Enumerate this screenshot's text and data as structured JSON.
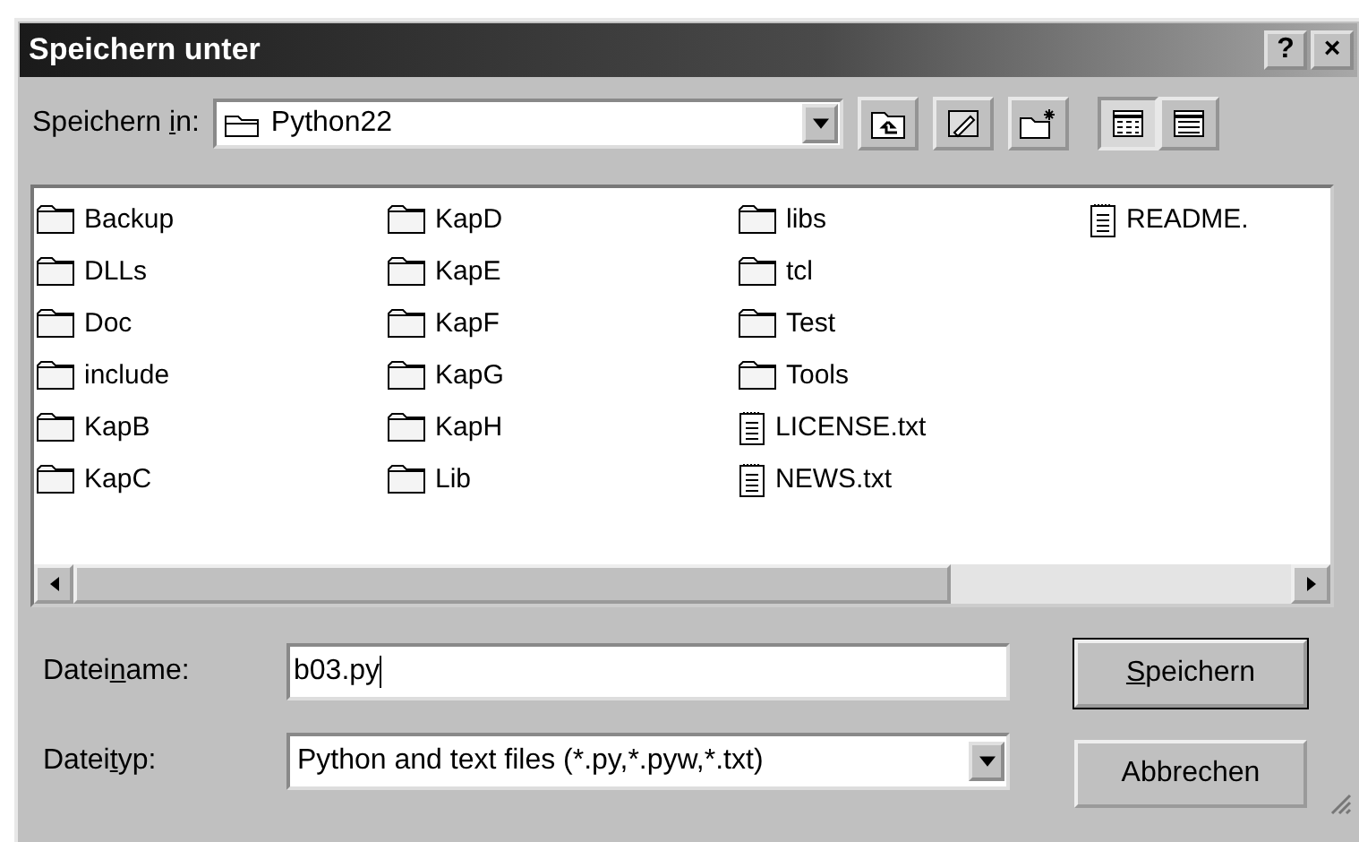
{
  "window": {
    "title": "Speichern unter",
    "help_button": "?",
    "close_button": "×"
  },
  "location": {
    "label": {
      "before": "Speichern ",
      "accel": "i",
      "after": "n:"
    },
    "value": "Python22"
  },
  "view_buttons": [
    {
      "kind": "list",
      "selected": true
    },
    {
      "kind": "details",
      "selected": false
    }
  ],
  "files": [
    {
      "name": "Backup",
      "kind": "folder"
    },
    {
      "name": "DLLs",
      "kind": "folder"
    },
    {
      "name": "Doc",
      "kind": "folder"
    },
    {
      "name": "include",
      "kind": "folder"
    },
    {
      "name": "KapB",
      "kind": "folder"
    },
    {
      "name": "KapC",
      "kind": "folder"
    },
    {
      "name": "KapD",
      "kind": "folder"
    },
    {
      "name": "KapE",
      "kind": "folder"
    },
    {
      "name": "KapF",
      "kind": "folder"
    },
    {
      "name": "KapG",
      "kind": "folder"
    },
    {
      "name": "KapH",
      "kind": "folder"
    },
    {
      "name": "Lib",
      "kind": "folder"
    },
    {
      "name": "libs",
      "kind": "folder"
    },
    {
      "name": "tcl",
      "kind": "folder"
    },
    {
      "name": "Test",
      "kind": "folder"
    },
    {
      "name": "Tools",
      "kind": "folder"
    },
    {
      "name": "LICENSE.txt",
      "kind": "file"
    },
    {
      "name": "NEWS.txt",
      "kind": "file"
    },
    {
      "name": "README.",
      "kind": "file"
    }
  ],
  "filename": {
    "label": {
      "before": "Datei",
      "accel": "n",
      "after": "ame:"
    },
    "value": "b03.py"
  },
  "filetype": {
    "label": {
      "before": "Datei",
      "accel": "t",
      "after": "yp:"
    },
    "value": "Python and text files (*.py,*.pyw,*.txt)"
  },
  "buttons": [
    {
      "label": {
        "accel": "S",
        "after": "peichern"
      },
      "default": true
    },
    {
      "label": {
        "after": "Abbrechen"
      },
      "default": false
    }
  ]
}
